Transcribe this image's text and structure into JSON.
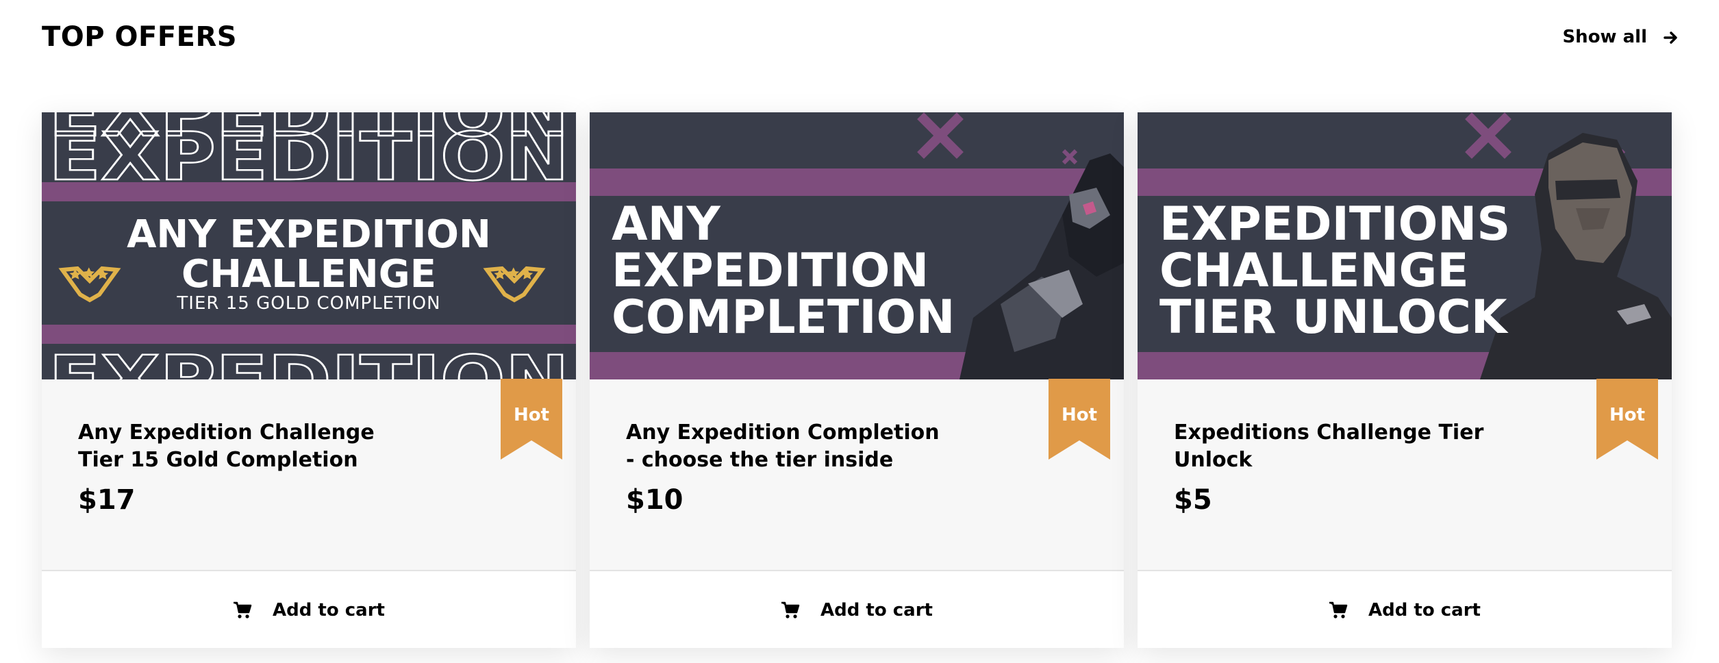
{
  "section": {
    "title": "TOP OFFERS",
    "show_all_label": "Show all",
    "show_all_icon": "arrow-right-icon"
  },
  "colors": {
    "banner_bg": "#393d4a",
    "purple_stripe": "#7e4d7d",
    "ribbon": "#e09a48",
    "emblem_gold": "#e0b24a"
  },
  "offers": [
    {
      "banner_lines": [
        "ANY EXPEDITION",
        "CHALLENGE",
        "TIER 15 GOLD COMPLETION"
      ],
      "banner_outline_text": "EXPEDITION",
      "badge": "Hot",
      "name": "Any Expedition Challenge Tier 15 Gold Completion",
      "price": "$17",
      "cart_label": "Add to cart",
      "cart_icon": "cart-icon"
    },
    {
      "banner_lines": [
        "ANY",
        "EXPEDITION",
        "COMPLETION"
      ],
      "badge": "Hot",
      "name": "Any Expedition Completion - choose the tier inside",
      "price": "$10",
      "cart_label": "Add to cart",
      "cart_icon": "cart-icon"
    },
    {
      "banner_lines": [
        "EXPEDITIONS",
        "CHALLENGE",
        "TIER UNLOCK"
      ],
      "badge": "Hot",
      "name": "Expeditions Challenge Tier Unlock",
      "price": "$5",
      "cart_label": "Add to cart",
      "cart_icon": "cart-icon"
    }
  ]
}
